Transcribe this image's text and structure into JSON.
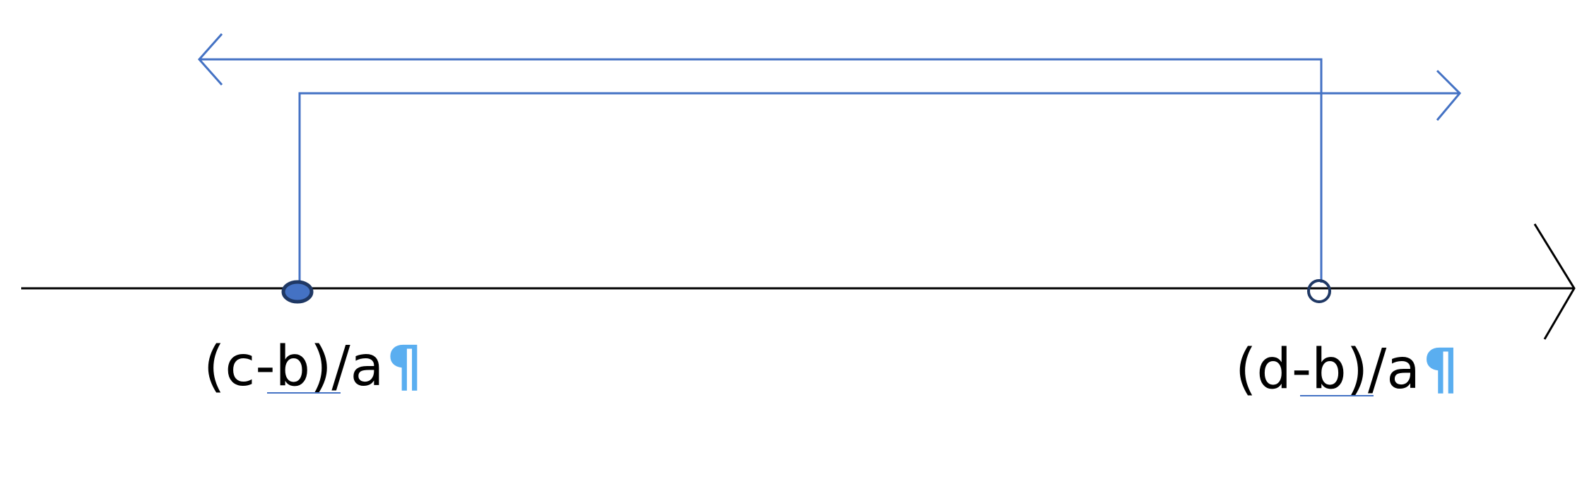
{
  "labels": {
    "left": "(c-b)/a",
    "right": "(d-b)/a",
    "pilcrow": "¶"
  },
  "colors": {
    "axis": "#000000",
    "bracket": "#4472c4",
    "point_fill": "#4472c4",
    "point_stroke": "#1f3864",
    "pilcrow": "#5aaef0"
  },
  "points": {
    "left": {
      "style": "closed"
    },
    "right": {
      "style": "open"
    }
  }
}
